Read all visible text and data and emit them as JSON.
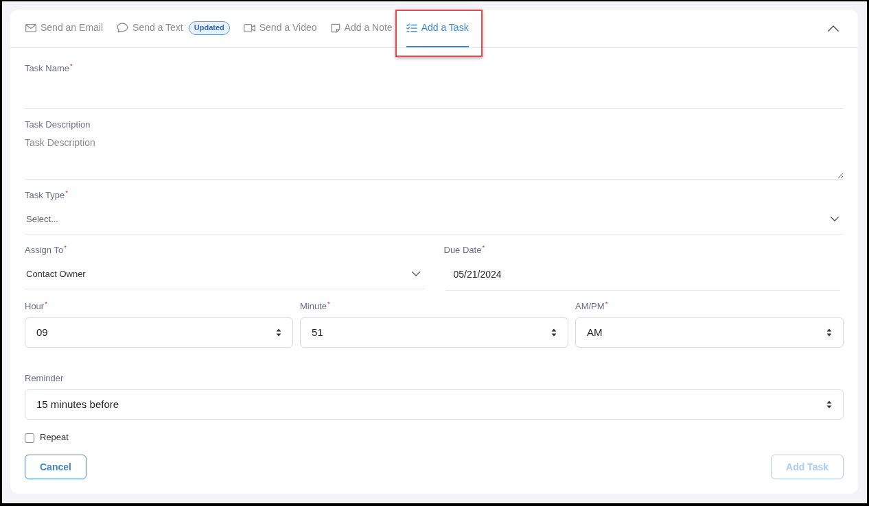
{
  "panel": {
    "expanded": true
  },
  "tabs": [
    {
      "kind": "email",
      "label": "Send an Email",
      "selected": false,
      "highlighted": false
    },
    {
      "kind": "text",
      "label": "Send a Text",
      "badge": "Updated",
      "selected": false,
      "highlighted": false
    },
    {
      "kind": "video",
      "label": "Send a Video",
      "selected": false,
      "highlighted": false
    },
    {
      "kind": "note",
      "label": "Add a Note",
      "selected": false,
      "highlighted": false
    },
    {
      "kind": "task",
      "label": "Add a Task",
      "selected": true,
      "highlighted": true
    }
  ],
  "form": {
    "rows": [
      {
        "fields": [
          {
            "kind": "text",
            "label": "Task Name$^{*}$"
          }
        ]
      },
      {
        "fields": [
          {
            "kind": "textarea",
            "label": "Task Description",
            "placeholder": "Task Description"
          }
        ]
      },
      {
        "fields": [
          {
            "kind": "dropdown",
            "label": "Task Type$^{*}$",
            "placeholder": "Select..."
          }
        ]
      },
      {
        "fields": [
          {
            "kind": "dropdown",
            "label": "Assign To$^{*}$",
            "value": "Contact Owner"
          },
          {
            "kind": "date",
            "label": "Due Date$^{*}$",
            "value": "05/21/2024"
          }
        ]
      },
      {
        "fields": [
          {
            "kind": "select",
            "label": "Hour$^{*}$",
            "value": "09"
          },
          {
            "kind": "select",
            "label": "Minute$^{*}$",
            "value": "51"
          },
          {
            "kind": "select",
            "label": "AM/PM$^{*}$",
            "value": "AM"
          }
        ]
      },
      {
        "fields": [
          {
            "kind": "select",
            "label": "Reminder",
            "value": "15 minutes before"
          }
        ]
      }
    ],
    "repeat": {
      "label": "Repeat",
      "checked": false
    }
  },
  "buttons": [
    {
      "label": "Cancel",
      "disabled": false
    },
    {
      "label": "Add Task",
      "disabled": true
    }
  ]
}
